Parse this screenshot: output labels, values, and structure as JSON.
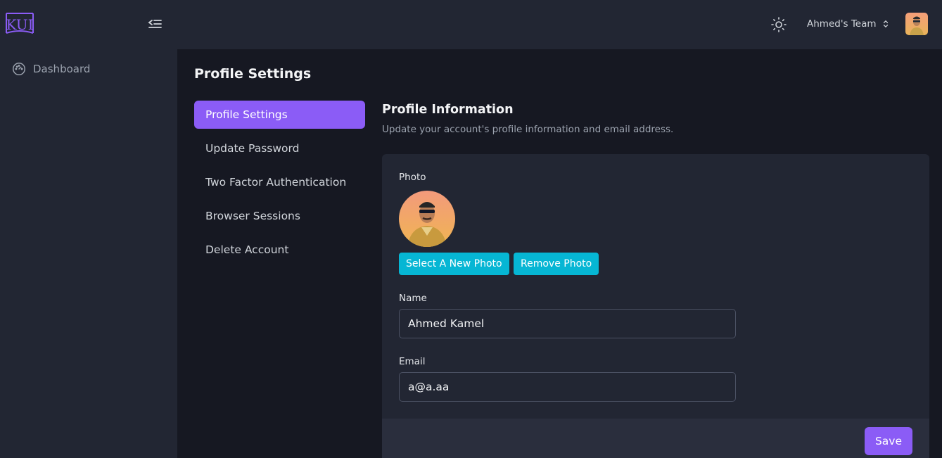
{
  "app": {
    "logo_text": "KUI"
  },
  "sidebar": {
    "items": [
      {
        "label": "Dashboard",
        "icon": "dashboard-gauge-icon"
      }
    ]
  },
  "topbar": {
    "team_name": "Ahmed's Team",
    "theme_icon": "sun-icon"
  },
  "page": {
    "title": "Profile Settings"
  },
  "settings_nav": {
    "items": [
      {
        "label": "Profile Settings",
        "active": true
      },
      {
        "label": "Update Password",
        "active": false
      },
      {
        "label": "Two Factor Authentication",
        "active": false
      },
      {
        "label": "Browser Sessions",
        "active": false
      },
      {
        "label": "Delete Account",
        "active": false
      }
    ]
  },
  "profile": {
    "section_title": "Profile Information",
    "section_desc": "Update your account's profile information and email address.",
    "photo_label": "Photo",
    "select_photo_label": "Select A New Photo",
    "remove_photo_label": "Remove Photo",
    "name_label": "Name",
    "name_value": "Ahmed Kamel",
    "email_label": "Email",
    "email_value": "a@a.aa",
    "save_label": "Save"
  },
  "colors": {
    "accent": "#8b5cf6",
    "cyan": "#06b6d4",
    "surface": "#222633",
    "background": "#161822"
  }
}
